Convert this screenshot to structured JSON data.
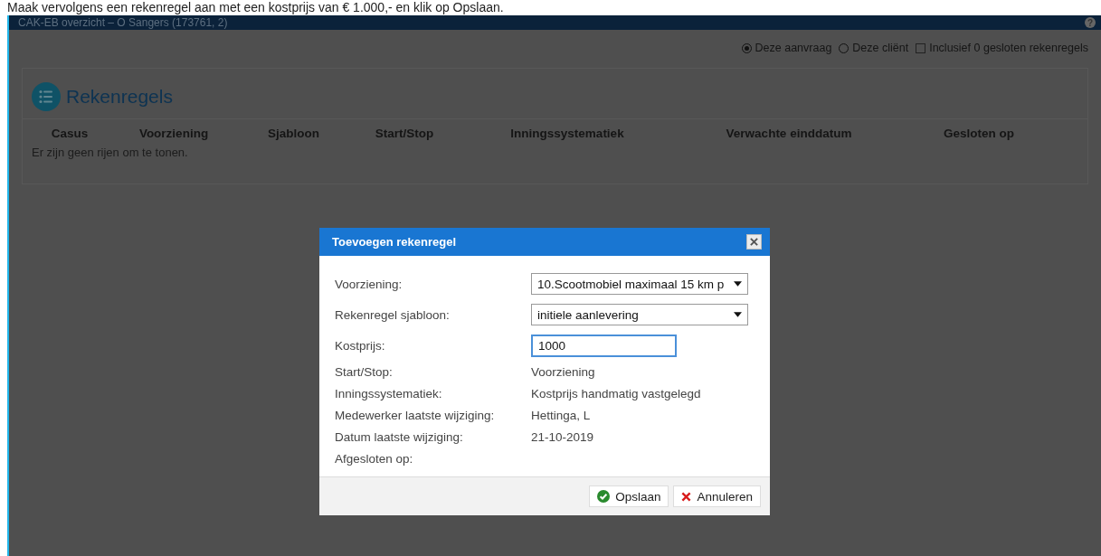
{
  "instruction": "Maak vervolgens een rekenregel aan met een kostprijs van € 1.000,- en klik op Opslaan.",
  "window": {
    "title": "CAK-EB overzicht – O Sangers (173761, 2)",
    "help_glyph": "?"
  },
  "scope_options": [
    {
      "kind": "radio",
      "label": "Deze aanvraag",
      "selected": true
    },
    {
      "kind": "radio",
      "label": "Deze cliënt",
      "selected": false
    },
    {
      "kind": "checkbox",
      "label": "Inclusief 0 gesloten rekenregels",
      "checked": false
    }
  ],
  "panel": {
    "title": "Rekenregels",
    "table": {
      "columns": [
        "Casus",
        "Voorziening",
        "Sjabloon",
        "Start/Stop",
        "Inningssystematiek",
        "Verwachte einddatum",
        "Gesloten op"
      ],
      "empty_message": "Er zijn geen rijen om te tonen."
    }
  },
  "dialog": {
    "title": "Toevoegen rekenregel",
    "fields": [
      {
        "kind": "select",
        "label": "Voorziening:",
        "value": "10.Scootmobiel maximaal 15 km p"
      },
      {
        "kind": "select",
        "label": "Rekenregel sjabloon:",
        "value": "initiele aanlevering"
      },
      {
        "kind": "input",
        "label": "Kostprijs:",
        "value": "1000",
        "focused": true
      },
      {
        "kind": "text",
        "label": "Start/Stop:",
        "value": "Voorziening"
      },
      {
        "kind": "text",
        "label": "Inningssystematiek:",
        "value": "Kostprijs handmatig vastgelegd"
      },
      {
        "kind": "text",
        "label": "Medewerker laatste wijziging:",
        "value": "Hettinga, L"
      },
      {
        "kind": "text",
        "label": "Datum laatste wijziging:",
        "value": "21-10-2019"
      },
      {
        "kind": "text",
        "label": "Afgesloten op:"
      }
    ],
    "buttons": [
      {
        "kind": "save",
        "label": "Opslaan"
      },
      {
        "kind": "cancel",
        "label": "Annuleren"
      }
    ]
  }
}
